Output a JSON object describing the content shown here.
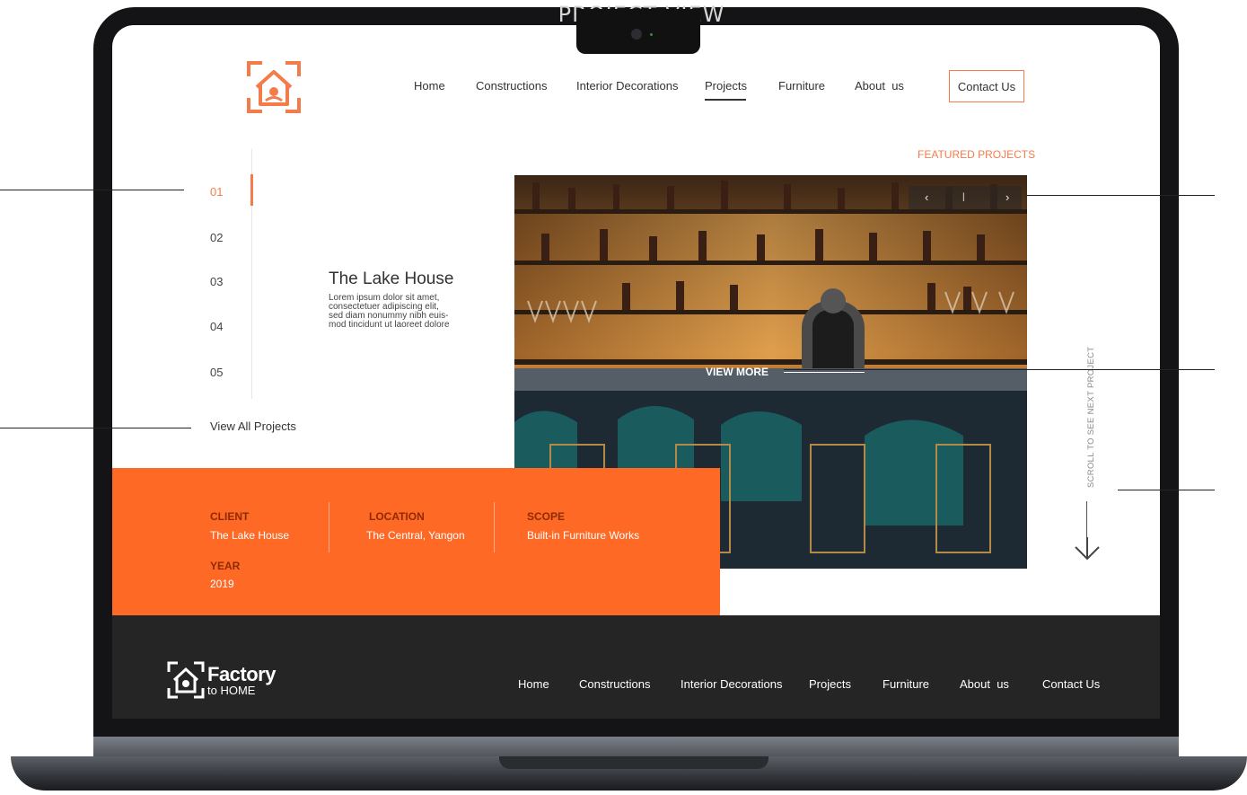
{
  "presentation": {
    "title": "PROJECT VIEW"
  },
  "header": {
    "nav": [
      "Home",
      "Constructions",
      "Interior Decorations",
      "Projects",
      "Furniture",
      "About  us"
    ],
    "active_nav": "Projects",
    "contact_label": "Contact Us"
  },
  "featured_label": "FEATURED PROJECTS",
  "project_list": {
    "numbers": [
      "01",
      "02",
      "03",
      "04",
      "05"
    ],
    "active": "01",
    "view_all": "View All Projects"
  },
  "project": {
    "title": "The Lake House",
    "description_lines": [
      "Lorem ipsum dolor sit amet,",
      "consectetuer adipiscing elit,",
      "sed diam nonummy nibh euis-",
      "mod tincidunt ut laoreet dolore"
    ],
    "view_more": "VIEW MORE"
  },
  "slider": {
    "prev": "‹",
    "divider": "|",
    "next": "›"
  },
  "info": {
    "client_label": "CLIENT",
    "client_value": "The Lake House",
    "location_label": "LOCATION",
    "location_value": "The Central, Yangon",
    "scope_label": "SCOPE",
    "scope_value": "Built-in Furniture Works",
    "year_label": "YEAR",
    "year_value": "2019"
  },
  "scroll_hint": "SCROLL TO SEE NEXT PROJECT",
  "footer": {
    "logo_main": "Factory",
    "logo_sub": "to HOME",
    "nav": [
      "Home",
      "Constructions",
      "Interior Decorations",
      "Projects",
      "Furniture",
      "About  us",
      "Contact Us"
    ]
  },
  "colors": {
    "accent": "#fe6a26",
    "accent_text": "#f47c4b",
    "footer_bg": "#252525"
  }
}
